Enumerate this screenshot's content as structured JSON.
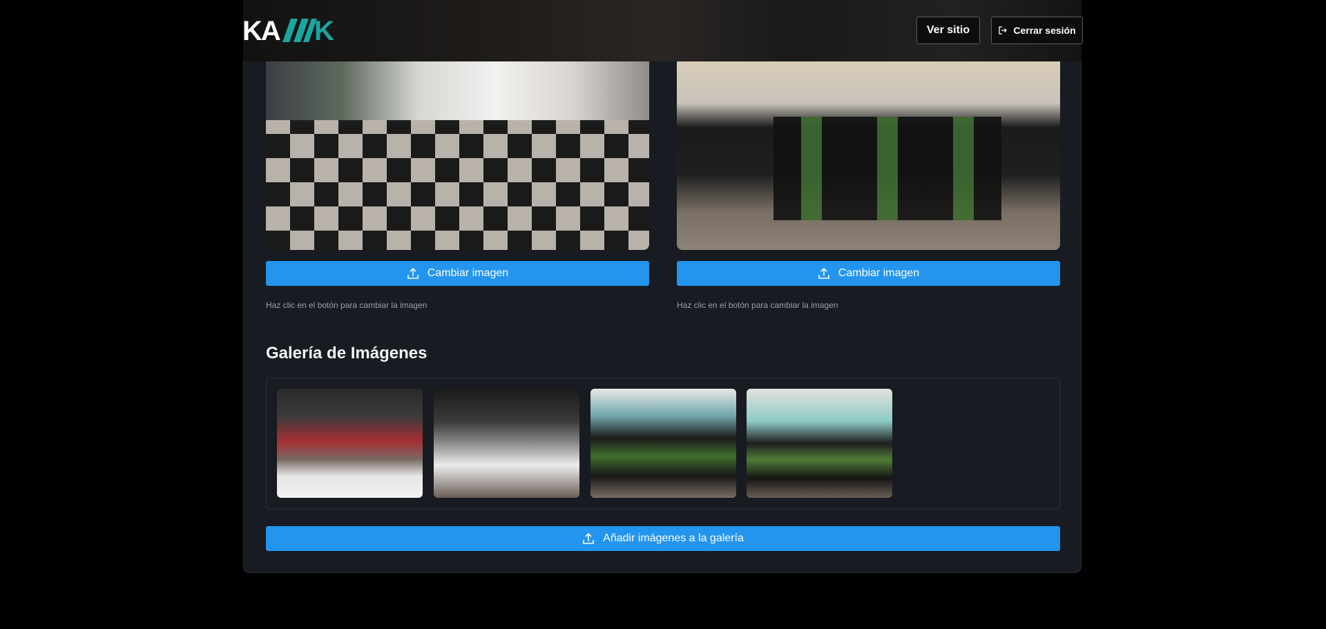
{
  "header": {
    "logo_text": "KAMAK",
    "ver_sitio": "Ver sitio",
    "cerrar_sesion": "Cerrar sesión"
  },
  "featured": [
    {
      "button_label": "Cambiar imagen",
      "hint": "Haz clic en el botón para cambiar la imagen",
      "icon": "upload-icon"
    },
    {
      "button_label": "Cambiar imagen",
      "hint": "Haz clic en el botón para cambiar la imagen",
      "icon": "upload-icon"
    }
  ],
  "gallery": {
    "title": "Galería de Imágenes",
    "add_button": "Añadir imágenes a la galería",
    "thumbnail_count": 4
  },
  "colors": {
    "accent": "#2395ef",
    "logo_teal": "#1aa6a0",
    "background": "#000000",
    "panel": "#181b21"
  }
}
